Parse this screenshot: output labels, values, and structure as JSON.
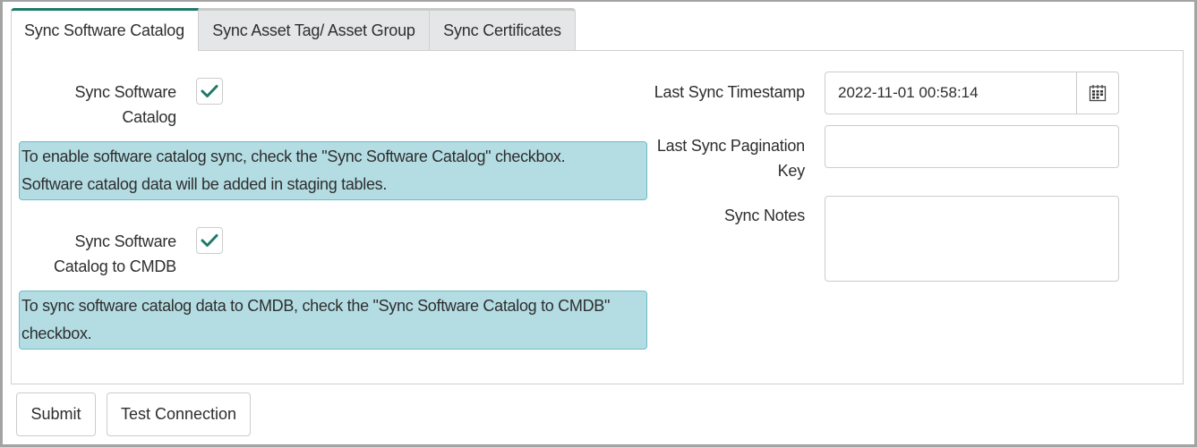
{
  "tabs": [
    {
      "label": "Sync Software Catalog",
      "active": true
    },
    {
      "label": "Sync Asset Tag/ Asset Group",
      "active": false
    },
    {
      "label": "Sync Certificates",
      "active": false
    }
  ],
  "form": {
    "sync_catalog": {
      "label_line1": "Sync Software",
      "label_line2": "Catalog",
      "checked": true,
      "info_line1": "To enable software catalog sync, check the \"Sync Software Catalog\" checkbox.",
      "info_line2": "Software catalog data will be added in staging tables."
    },
    "sync_cmdb": {
      "label_line1": "Sync Software",
      "label_line2": "Catalog to CMDB",
      "checked": true,
      "info_line1": "To sync software catalog data to CMDB, check the \"Sync Software Catalog to CMDB\"",
      "info_line2": "checkbox."
    },
    "last_sync_timestamp": {
      "label": "Last Sync Timestamp",
      "value": "2022-11-01 00:58:14",
      "icon": "calendar-icon"
    },
    "last_sync_pagination_key": {
      "label_line1": "Last Sync Pagination",
      "label_line2": "Key",
      "value": ""
    },
    "sync_notes": {
      "label": "Sync Notes",
      "value": ""
    }
  },
  "buttons": {
    "submit": "Submit",
    "test_connection": "Test Connection"
  },
  "colors": {
    "accent": "#1f7a6a",
    "info_bg": "#b3dde3",
    "info_border": "#6cbcc9"
  }
}
